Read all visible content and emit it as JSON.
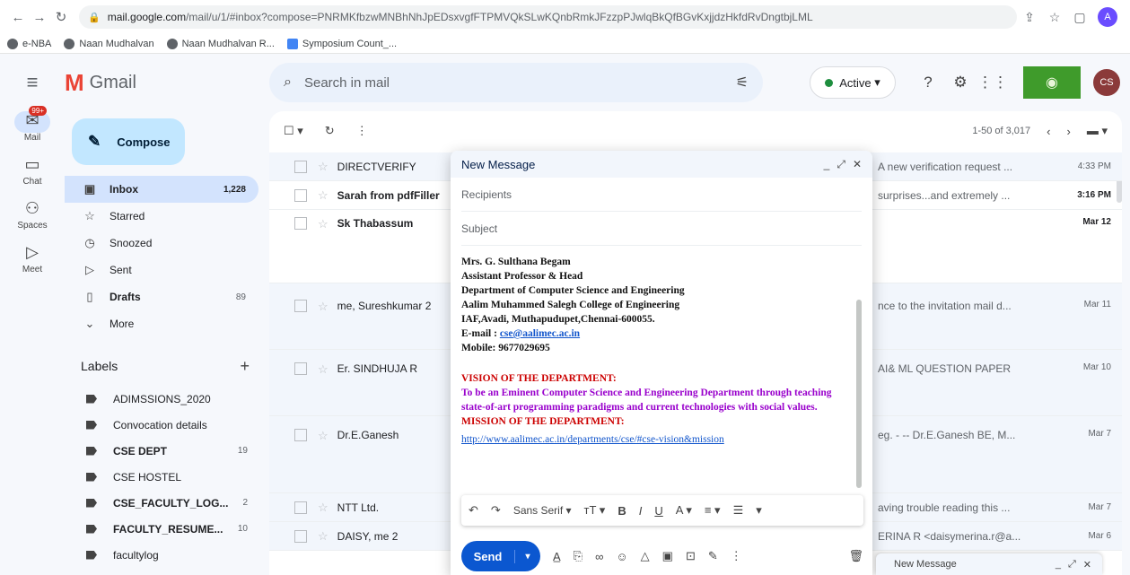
{
  "browser": {
    "url_host": "mail.google.com",
    "url_path": "/mail/u/1/#inbox?compose=PNRMKfbzwMNBhNhJpEDsxvgfFTPMVQkSLwKQnbRmkJFzzpPJwlqBkQfBGvKxjjdzHkfdRvDngtbjLML",
    "bookmarks": [
      "e-NBA",
      "Naan Mudhalvan",
      "Naan Mudhalvan R...",
      "Symposium Count_..."
    ],
    "profile_letter": "A"
  },
  "header": {
    "app_name": "Gmail",
    "search_placeholder": "Search in mail",
    "status": "Active",
    "avatar_initials": "CS"
  },
  "rail": {
    "items": [
      {
        "label": "Mail",
        "badge": "99+"
      },
      {
        "label": "Chat"
      },
      {
        "label": "Spaces"
      },
      {
        "label": "Meet"
      }
    ]
  },
  "sidebar": {
    "compose_label": "Compose",
    "nav": [
      {
        "label": "Inbox",
        "count": "1,228"
      },
      {
        "label": "Starred",
        "count": ""
      },
      {
        "label": "Snoozed",
        "count": ""
      },
      {
        "label": "Sent",
        "count": ""
      },
      {
        "label": "Drafts",
        "count": "89"
      },
      {
        "label": "More",
        "count": ""
      }
    ],
    "labels_title": "Labels",
    "labels": [
      {
        "label": "ADIMSSIONS_2020",
        "count": ""
      },
      {
        "label": "Convocation details",
        "count": ""
      },
      {
        "label": "CSE DEPT",
        "count": "19"
      },
      {
        "label": "CSE HOSTEL",
        "count": ""
      },
      {
        "label": "CSE_FACULTY_LOG...",
        "count": "2"
      },
      {
        "label": "FACULTY_RESUME...",
        "count": "10"
      },
      {
        "label": "facultylog",
        "count": ""
      }
    ]
  },
  "list": {
    "pager": "1-50 of 3,017",
    "rows": [
      {
        "sender": "DIRECTVERIFY",
        "snippet": "A new verification request ...",
        "date": "4:33 PM"
      },
      {
        "sender": "Sarah from pdfFiller",
        "snippet": "surprises...and extremely ...",
        "date": "3:16 PM"
      },
      {
        "sender": "Sk Thabassum",
        "snippet": "",
        "date": "Mar 12"
      },
      {
        "sender": "me, Sureshkumar 2",
        "snippet": "nce to the invitation mail d...",
        "date": "Mar 11"
      },
      {
        "sender": "Er. SINDHUJA R",
        "snippet": "AI& ML QUESTION PAPER",
        "date": "Mar 10"
      },
      {
        "sender": "Dr.E.Ganesh",
        "snippet": "eg. - -- Dr.E.Ganesh BE, M...",
        "date": "Mar 7"
      },
      {
        "sender": "NTT Ltd.",
        "snippet": "aving trouble reading this ...",
        "date": "Mar 7"
      },
      {
        "sender": "DAISY, me 2",
        "snippet": "ERINA R <daisymerina.r@a...",
        "date": "Mar 6"
      }
    ]
  },
  "compose": {
    "title": "New Message",
    "recipients_placeholder": "Recipients",
    "subject_placeholder": "Subject",
    "signature": {
      "name": "Mrs. G. Sulthana Begam",
      "role": "Assistant Professor & Head",
      "dept": "Department of Computer Science and Engineering",
      "college": "Aalim Muhammed Salegh College of Engineering",
      "address": "IAF,Avadi, Muthapudupet,Chennai-600055.",
      "email_label": "E-mail : ",
      "email": "cse@aalimec.ac.in",
      "mobile": "Mobile: 9677029695",
      "vision_title": "VISION OF THE DEPARTMENT:",
      "vision_text": "To be an Eminent Computer Science and Engineering Department through teaching state-of-art programming paradigms and current technologies with social values.",
      "mission_title": "MISSION OF THE DEPARTMENT:",
      "link": "http://www.aalimec.ac.in/departments/cse/#cse-vision&mission"
    },
    "font_name": "Sans Serif",
    "send_label": "Send"
  },
  "minimized": {
    "title": "New Message"
  }
}
